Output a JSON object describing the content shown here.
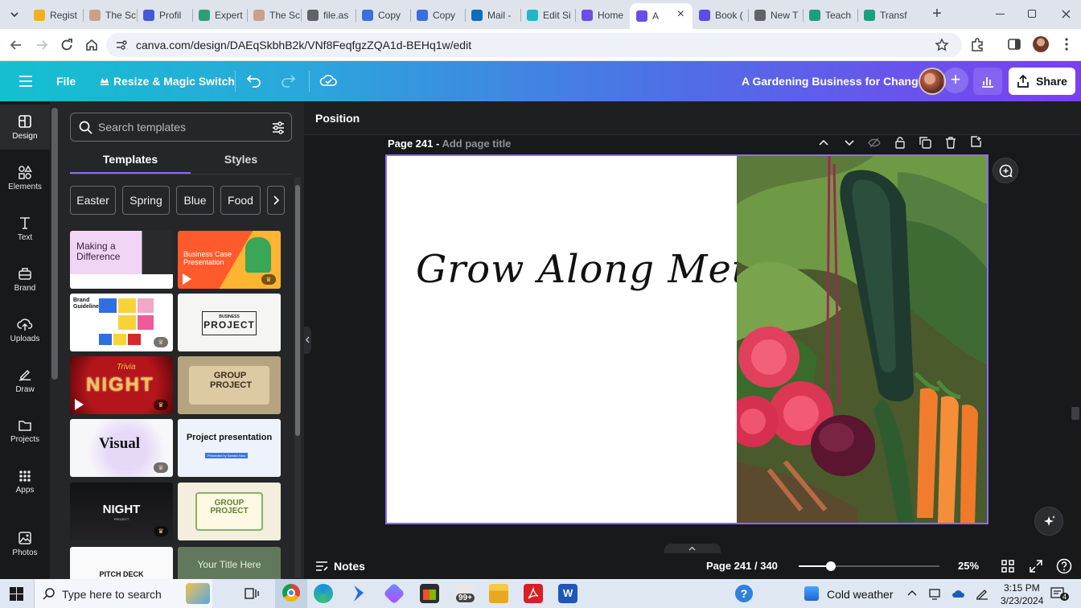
{
  "browser": {
    "tabs": [
      {
        "label": "Regist",
        "icon_color": "#f2b01e"
      },
      {
        "label": "The Sc",
        "icon_color": "#c9a08a"
      },
      {
        "label": "Profil",
        "icon_color": "#4358e0"
      },
      {
        "label": "Expert",
        "icon_color": "#2f9e78"
      },
      {
        "label": "The Sc",
        "icon_color": "#c9a08a"
      },
      {
        "label": "file.as",
        "icon_color": "#5f6368"
      },
      {
        "label": "Copy",
        "icon_color": "#3b6fe0"
      },
      {
        "label": "Copy",
        "icon_color": "#3b6fe0"
      },
      {
        "label": "Mail -",
        "icon_color": "#0f6cbd"
      },
      {
        "label": "Edit Si",
        "icon_color": "#20b8c9"
      },
      {
        "label": "Home",
        "icon_color": "#6a4ee8"
      },
      {
        "label": "A",
        "icon_color": "#6a4ee8"
      },
      {
        "label": "Book (",
        "icon_color": "#5b4ce6"
      },
      {
        "label": "New T",
        "icon_color": "#5f6368"
      },
      {
        "label": "Teach",
        "icon_color": "#1aa07a"
      },
      {
        "label": "Transf",
        "icon_color": "#1aa07a"
      }
    ],
    "url": "canva.com/design/DAEqSkbhB2k/VNf8FeqfgzZQA1d-BEHq1w/edit"
  },
  "header": {
    "file_label": "File",
    "resize_label": "Resize & Magic Switch",
    "doc_title": "A Gardening Business for Change",
    "share_label": "Share"
  },
  "rail": {
    "items": [
      {
        "label": "Design",
        "icon": "design-icon"
      },
      {
        "label": "Elements",
        "icon": "elements-icon"
      },
      {
        "label": "Text",
        "icon": "text-icon"
      },
      {
        "label": "Brand",
        "icon": "brand-icon"
      },
      {
        "label": "Uploads",
        "icon": "uploads-icon"
      },
      {
        "label": "Draw",
        "icon": "draw-icon"
      },
      {
        "label": "Projects",
        "icon": "projects-icon"
      },
      {
        "label": "Apps",
        "icon": "apps-icon"
      },
      {
        "label": "Photos",
        "icon": "photos-icon"
      }
    ]
  },
  "panel": {
    "search_placeholder": "Search templates",
    "tabs": [
      "Templates",
      "Styles"
    ],
    "chips": [
      "Easter",
      "Spring",
      "Blue",
      "Food"
    ],
    "templates": [
      {
        "title": "Making a Difference"
      },
      {
        "title": "Business Case Presentation"
      },
      {
        "title": "Brand Guidelines"
      },
      {
        "title": "BUSINESS PROJECT",
        "kicker": "BUSINESS",
        "main": "PROJECT"
      },
      {
        "title": "Trivia NIGHT",
        "kicker": "Trivia",
        "main": "NIGHT"
      },
      {
        "title": "GROUP PROJECT"
      },
      {
        "title": "Visual"
      },
      {
        "title": "Project presentation",
        "subtitle": "Presented by Sandra Haro"
      },
      {
        "title": "NIGHT",
        "subtitle": "PROJECT"
      },
      {
        "title": "GROUP PROJECT"
      },
      {
        "title": "PITCH DECK"
      },
      {
        "title": "Your Title Here"
      }
    ]
  },
  "toolbar": {
    "position_label": "Position"
  },
  "page": {
    "label": "Page 241 -",
    "title_placeholder": "Add page title",
    "heading": "Grow Along Method"
  },
  "bottom": {
    "notes_label": "Notes",
    "page_indicator": "Page 241 / 340",
    "zoom": "25%"
  },
  "taskbar": {
    "search_placeholder": "Type here to search",
    "badge": "99+",
    "weather": "Cold weather",
    "time": "3:15 PM",
    "date": "3/23/2024",
    "notifications": "4"
  }
}
